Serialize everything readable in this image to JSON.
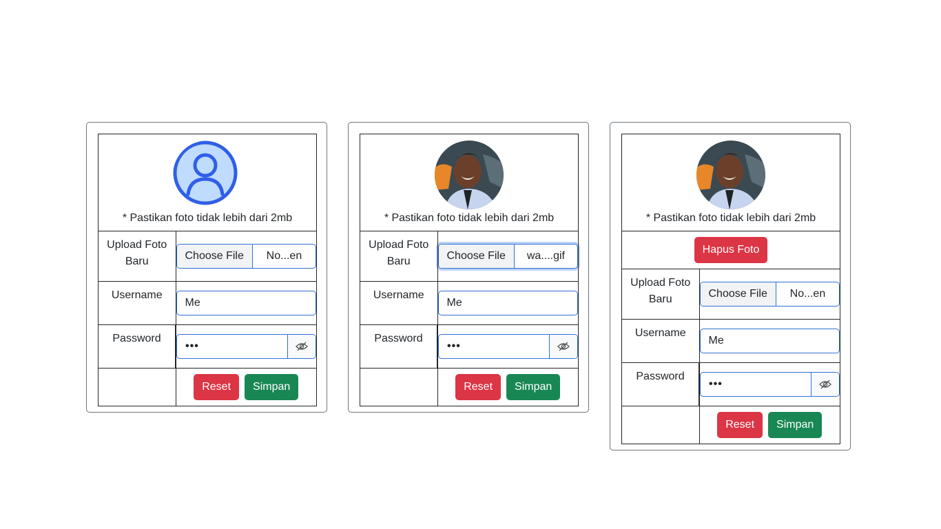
{
  "cards": [
    {
      "photo": "default-user-icon",
      "note": "* Pastikan foto tidak lebih dari 2mb",
      "upload_label": "Upload Foto Baru",
      "choose_file": "Choose File",
      "file_name": "No...en",
      "username_label": "Username",
      "username_value": "Me",
      "password_label": "Password",
      "password_value": "•••",
      "reset": "Reset",
      "save": "Simpan"
    },
    {
      "photo": "profile-photo",
      "note": "* Pastikan foto tidak lebih dari 2mb",
      "upload_label": "Upload Foto Baru",
      "choose_file": "Choose File",
      "file_name": "wa....gif",
      "username_label": "Username",
      "username_value": "Me",
      "password_label": "Password",
      "password_value": "•••",
      "reset": "Reset",
      "save": "Simpan"
    },
    {
      "photo": "profile-photo",
      "note": "* Pastikan foto tidak lebih dari 2mb",
      "delete_photo": "Hapus Foto",
      "upload_label": "Upload Foto Baru",
      "choose_file": "Choose File",
      "file_name": "No...en",
      "username_label": "Username",
      "username_value": "Me",
      "password_label": "Password",
      "password_value": "•••",
      "reset": "Reset",
      "save": "Simpan"
    }
  ],
  "colors": {
    "primary": "#2f6fd6",
    "danger": "#dc3545",
    "success": "#198754"
  }
}
